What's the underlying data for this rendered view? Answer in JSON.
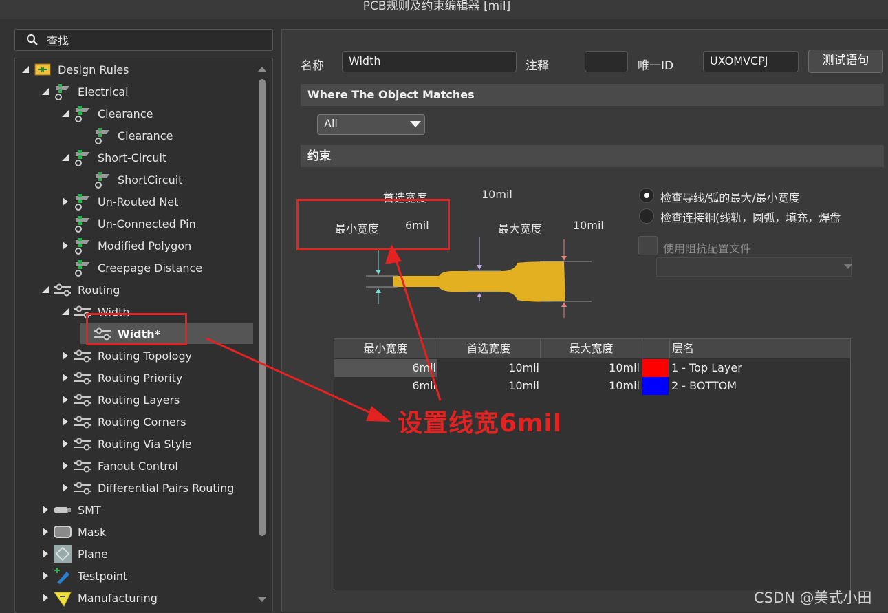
{
  "window": {
    "title": "PCB规则及约束编辑器 [mil]"
  },
  "search": {
    "label": "查找"
  },
  "tree": [
    {
      "label": "Design Rules",
      "icon": "design-rules-icon",
      "expanded": true
    },
    {
      "label": "Electrical",
      "icon": "rule-category-icon",
      "expanded": true
    },
    {
      "label": "Clearance",
      "icon": "rule-category-icon",
      "expanded": true
    },
    {
      "label": "Clearance",
      "icon": "rule-icon"
    },
    {
      "label": "Short-Circuit",
      "icon": "rule-category-icon",
      "expanded": true
    },
    {
      "label": "ShortCircuit",
      "icon": "rule-icon"
    },
    {
      "label": "Un-Routed Net",
      "icon": "rule-category-icon",
      "expanded": false
    },
    {
      "label": "Un-Connected Pin",
      "icon": "rule-category-icon"
    },
    {
      "label": "Modified Polygon",
      "icon": "rule-category-icon",
      "expanded": false
    },
    {
      "label": "Creepage Distance",
      "icon": "rule-category-icon"
    },
    {
      "label": "Routing",
      "icon": "routing-icon",
      "expanded": true
    },
    {
      "label": "Width",
      "icon": "routing-icon",
      "expanded": true
    },
    {
      "label": "Width*",
      "icon": "routing-icon",
      "selected": true
    },
    {
      "label": "Routing Topology",
      "icon": "routing-icon",
      "expanded": false
    },
    {
      "label": "Routing Priority",
      "icon": "routing-icon",
      "expanded": false
    },
    {
      "label": "Routing Layers",
      "icon": "routing-icon",
      "expanded": false
    },
    {
      "label": "Routing Corners",
      "icon": "routing-icon",
      "expanded": false
    },
    {
      "label": "Routing Via Style",
      "icon": "routing-icon",
      "expanded": false
    },
    {
      "label": "Fanout Control",
      "icon": "routing-icon",
      "expanded": false
    },
    {
      "label": "Differential Pairs Routing",
      "icon": "routing-icon",
      "expanded": false
    },
    {
      "label": "SMT",
      "icon": "smt-icon",
      "expanded": false
    },
    {
      "label": "Mask",
      "icon": "mask-icon",
      "expanded": false
    },
    {
      "label": "Plane",
      "icon": "plane-icon",
      "expanded": false
    },
    {
      "label": "Testpoint",
      "icon": "testpoint-icon",
      "expanded": false
    },
    {
      "label": "Manufacturing",
      "icon": "manufacturing-icon",
      "expanded": false
    }
  ],
  "rule": {
    "name_label": "名称",
    "name_value": "Width",
    "comment_label": "注释",
    "comment_value": "",
    "uid_label": "唯一ID",
    "uid_value": "UXOMVCPJ",
    "test_button": "测试语句"
  },
  "match": {
    "header": "Where The Object Matches",
    "selected": "All"
  },
  "constraints": {
    "header": "约束",
    "preferred_label": "首选宽度",
    "preferred_value": "10mil",
    "min_label": "最小宽度",
    "min_value": "6mil",
    "max_label": "最大宽度",
    "max_value": "10mil",
    "option1": "检查导线/弧的最大/最小宽度",
    "option2": "检查连接铜(线轨，圆弧，填充，焊盘",
    "option1_checked": true,
    "impedance_label": "使用阻抗配置文件",
    "impedance_checked": false,
    "trace_color": "#e3b022"
  },
  "table": {
    "columns": [
      "最小宽度",
      "首选宽度",
      "最大宽度",
      "",
      "层名"
    ],
    "rows": [
      {
        "min": "6mil",
        "pref": "10mil",
        "max": "10mil",
        "color": "#ff0000",
        "layer": "1 - Top Layer"
      },
      {
        "min": "6mil",
        "pref": "10mil",
        "max": "10mil",
        "color": "#0000ff",
        "layer": "2 - BOTTOM"
      }
    ]
  },
  "annotation": {
    "text": "设置线宽6mil",
    "color": "#e32222"
  },
  "watermark": "CSDN @美式小田"
}
